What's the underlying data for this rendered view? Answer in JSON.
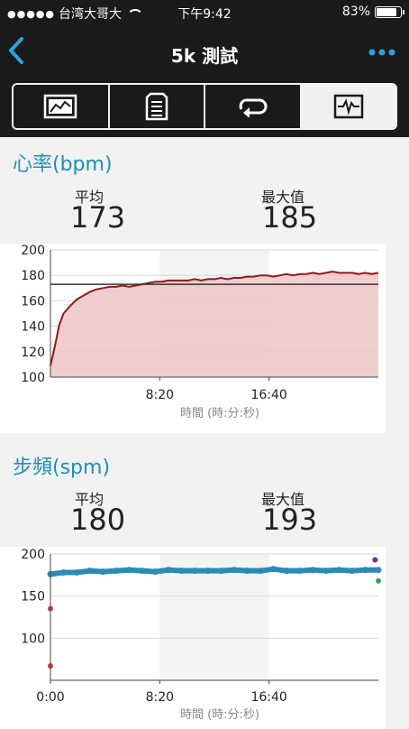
{
  "status_bar": {
    "carrier": "台湾大哥大",
    "signal_dots": "●●●●●",
    "time": "下午9:42",
    "battery_percent": "83%",
    "battery_level": 0.83
  },
  "nav": {
    "title": "5k 測試"
  },
  "tabs": [
    {
      "icon": "summary-chart-icon",
      "active": false
    },
    {
      "icon": "document-list-icon",
      "active": false
    },
    {
      "icon": "laps-loop-icon",
      "active": false
    },
    {
      "icon": "heart-monitor-icon",
      "active": true
    }
  ],
  "heart_rate": {
    "title": "心率(bpm)",
    "avg_label": "平均",
    "avg_value": "173",
    "max_label": "最大值",
    "max_value": "185"
  },
  "cadence": {
    "title": "步頻(spm)",
    "avg_label": "平均",
    "avg_value": "180",
    "max_label": "最大值",
    "max_value": "193"
  },
  "chart_data": [
    {
      "type": "area",
      "xlabel": "時間 (時:分:秒)",
      "ylim": [
        100,
        200
      ],
      "yticks": [
        "200",
        "180",
        "160",
        "140",
        "120",
        "100"
      ],
      "xtick_labels": [
        "8:20",
        "16:40"
      ],
      "average_line": 173,
      "color": "#8b1c1c",
      "fill": "#efc4c4",
      "series": [
        {
          "x": [
            0,
            20,
            40,
            60,
            90,
            120,
            150,
            180,
            210,
            240,
            270,
            300,
            330,
            360,
            390,
            420,
            450,
            480,
            510,
            540,
            570,
            600,
            630,
            660,
            690,
            720,
            750,
            780,
            810,
            840,
            870,
            900,
            930,
            960,
            990,
            1020,
            1050,
            1080,
            1110,
            1140,
            1170,
            1200,
            1230,
            1260,
            1290,
            1320,
            1350,
            1380,
            1410,
            1440,
            1470,
            1500
          ],
          "values": [
            109,
            124,
            141,
            150,
            156,
            161,
            164,
            167,
            169,
            170,
            171,
            171,
            172,
            171,
            172,
            173,
            174,
            175,
            175,
            176,
            176,
            176,
            176,
            177,
            176,
            177,
            177,
            178,
            177,
            178,
            178,
            179,
            179,
            180,
            180,
            179,
            180,
            181,
            180,
            181,
            181,
            182,
            181,
            182,
            183,
            182,
            182,
            182,
            181,
            182,
            181,
            182
          ]
        }
      ]
    },
    {
      "type": "scatter",
      "xlabel": "時間 (時:分:秒)",
      "ylim": [
        50,
        200
      ],
      "yticks": [
        "200",
        "150",
        "100"
      ],
      "xtick_labels": [
        "0:00",
        "8:20",
        "16:40"
      ],
      "color": "#2b8bb5",
      "series": [
        {
          "x": [
            0,
            60,
            120,
            180,
            240,
            300,
            360,
            420,
            480,
            540,
            600,
            660,
            720,
            780,
            840,
            900,
            960,
            1020,
            1080,
            1140,
            1200,
            1260,
            1320,
            1380,
            1440,
            1500
          ],
          "values": [
            176,
            178,
            178,
            180,
            179,
            180,
            181,
            180,
            179,
            181,
            180,
            180,
            180,
            180,
            181,
            180,
            180,
            182,
            180,
            180,
            181,
            180,
            181,
            180,
            181,
            181
          ]
        }
      ],
      "outliers": [
        {
          "x": 0,
          "y": 135,
          "color": "#d04040"
        },
        {
          "x": 0,
          "y": 67,
          "color": "#d04040"
        },
        {
          "x": 1485,
          "y": 193,
          "color": "#7a2a9a"
        },
        {
          "x": 1500,
          "y": 168,
          "color": "#3aa84a"
        }
      ]
    }
  ]
}
